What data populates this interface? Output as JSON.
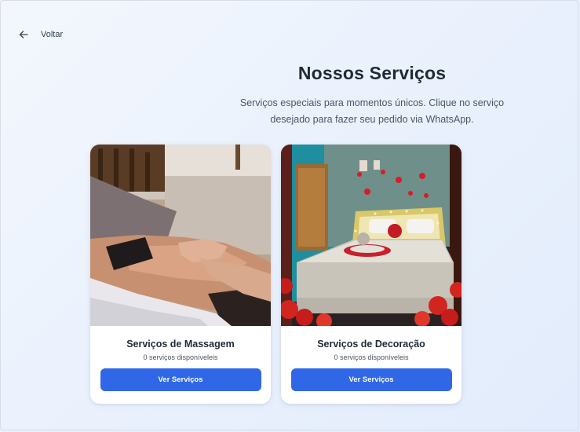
{
  "nav": {
    "back_label": "Voltar",
    "back_icon": "arrow-left-icon"
  },
  "header": {
    "title": "Nossos Serviços",
    "subtitle": "Serviços especiais para momentos únicos. Clique no serviço desejado para fazer seu pedido via WhatsApp."
  },
  "services": [
    {
      "name": "Serviços de Massagem",
      "count": "0 serviços disponíveleis",
      "button_label": "Ver Serviços",
      "image": "massage-photo"
    },
    {
      "name": "Serviços de Decoração",
      "count": "0 serviços disponíveleis",
      "button_label": "Ver Serviços",
      "image": "decorated-bedroom-photo"
    }
  ],
  "colors": {
    "accent": "#2f67e6",
    "title": "#1f2937",
    "text": "#4b5563"
  }
}
